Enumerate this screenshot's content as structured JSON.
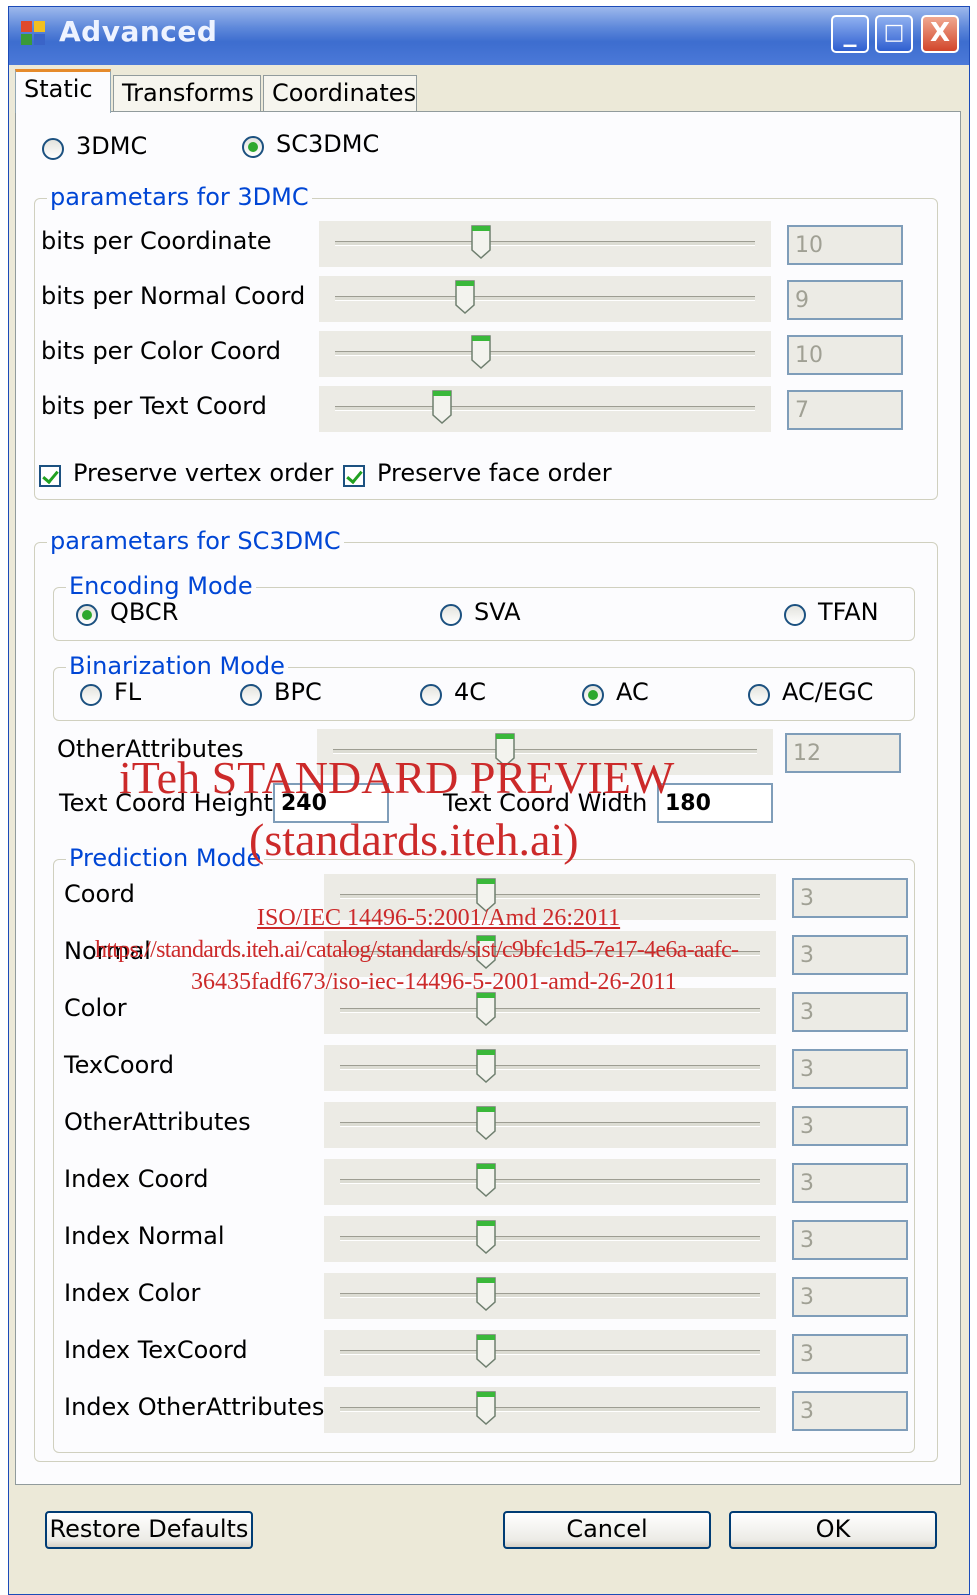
{
  "window": {
    "title": "Advanced",
    "minimize": "_",
    "maximize": "□",
    "close": "X"
  },
  "tabs": [
    "Static",
    "Transforms",
    "Coordinates"
  ],
  "mode": {
    "option1": "3DMC",
    "option2": "SC3DMC",
    "selected": "SC3DMC"
  },
  "group3dmc": {
    "title": "parametars for 3DMC",
    "rows": [
      {
        "label": "bits per Coordinate",
        "value": "10",
        "level": 0.34
      },
      {
        "label": "bits per Normal Coord",
        "value": "9",
        "level": 0.3
      },
      {
        "label": "bits per Color  Coord",
        "value": "10",
        "level": 0.34
      },
      {
        "label": "bits per Text Coord",
        "value": "7",
        "level": 0.24
      }
    ],
    "check_vertex": "Preserve vertex order",
    "check_face": "Preserve face order"
  },
  "groupsc3dmc": {
    "title": "parametars for SC3DMC",
    "encoding": {
      "title": "Encoding Mode",
      "options": [
        "QBCR",
        "SVA",
        "TFAN"
      ],
      "selected": "QBCR"
    },
    "binarization": {
      "title": "Binarization Mode",
      "options": [
        "FL",
        "BPC",
        "4C",
        "AC",
        "AC/EGC"
      ],
      "selected": "AC"
    },
    "other_attr": {
      "label": "OtherAttributes",
      "value": "12",
      "level": 0.4
    },
    "text_height_label": "Text Coord Height",
    "text_height_value": "240",
    "text_width_label": "Text Coord Width",
    "text_width_value": "180",
    "prediction": {
      "title": "Prediction Mode",
      "rows": [
        {
          "label": "Coord",
          "value": "3",
          "level": 0.34
        },
        {
          "label": "Normal",
          "value": "3",
          "level": 0.34
        },
        {
          "label": "Color",
          "value": "3",
          "level": 0.34
        },
        {
          "label": "TexCoord",
          "value": "3",
          "level": 0.34
        },
        {
          "label": "OtherAttributes",
          "value": "3",
          "level": 0.34
        },
        {
          "label": "Index Coord",
          "value": "3",
          "level": 0.34
        },
        {
          "label": "Index Normal",
          "value": "3",
          "level": 0.34
        },
        {
          "label": "Index Color",
          "value": "3",
          "level": 0.34
        },
        {
          "label": "Index TexCoord",
          "value": "3",
          "level": 0.34
        },
        {
          "label": "Index OtherAttributes",
          "value": "3",
          "level": 0.34
        }
      ]
    }
  },
  "buttons": {
    "restore": "Restore Defaults",
    "cancel": "Cancel",
    "ok": "OK"
  },
  "watermark": {
    "line1": "iTeh STANDARD PREVIEW",
    "line2": "(standards.iteh.ai)",
    "line3": "ISO/IEC 14496-5:2001/Amd 26:2011",
    "line4": "https://standards.iteh.ai/catalog/standards/sist/c9bfc1d5-7e17-4e6a-aafc-",
    "line5": "36435fadf673/iso-iec-14496-5-2001-amd-26-2011"
  }
}
